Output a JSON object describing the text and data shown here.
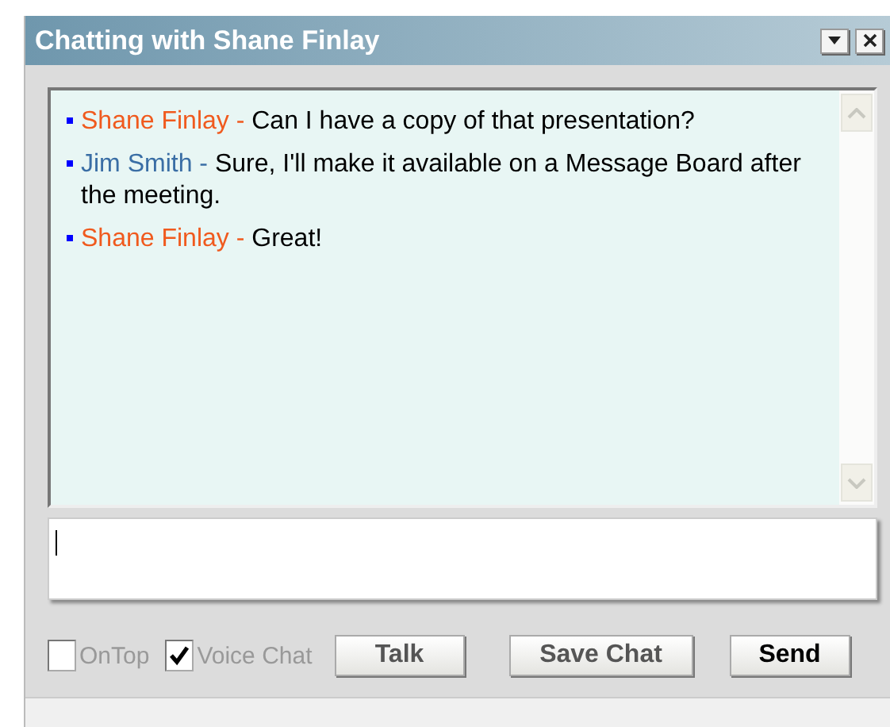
{
  "window": {
    "title": "Chatting with Shane Finlay",
    "controls": [
      {
        "kind": "menu"
      },
      {
        "kind": "close"
      }
    ]
  },
  "messages": [
    {
      "name": "Shane Finlay -",
      "color": "#f05a1e",
      "text": "Can I have a copy of that presentation?"
    },
    {
      "name": "Jim Smith -",
      "color": "#3a6ea5",
      "text": "Sure, I'll make it available on a Message Board after the meeting."
    },
    {
      "name": "Shane Finlay -",
      "color": "#f05a1e",
      "text": "Great!"
    }
  ],
  "options": [
    {
      "label": "OnTop",
      "checked": false
    },
    {
      "label": "Voice Chat",
      "checked": true
    }
  ],
  "buttons": [
    {
      "label": "Talk",
      "disabled": true
    },
    {
      "label": "Save Chat",
      "disabled": true
    },
    {
      "label": "Send",
      "disabled": false
    }
  ]
}
